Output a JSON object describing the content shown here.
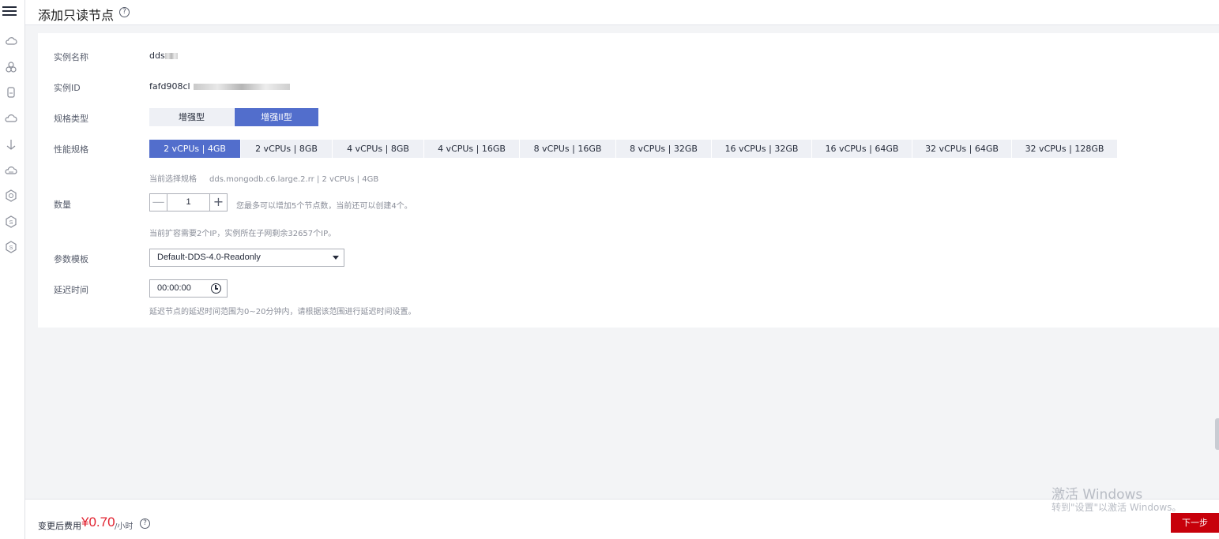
{
  "header": {
    "title": "添加只读节点",
    "help_icon": "question-circle-icon"
  },
  "rail": {
    "icons": [
      "cloud-icon",
      "cluster-icon",
      "database-icon",
      "cloud-outline-icon",
      "anchor-icon",
      "cloud-dots-icon",
      "hexagon-icon",
      "hexagon-s-icon",
      "hexagon-s2-icon"
    ]
  },
  "form": {
    "instance_name": {
      "label": "实例名称",
      "value": "dds"
    },
    "instance_id": {
      "label": "实例ID",
      "value": "fafd908cl"
    },
    "spec_type": {
      "label": "规格类型",
      "options": [
        "增强型",
        "增强II型"
      ],
      "selected": "增强II型"
    },
    "perf_spec": {
      "label": "性能规格",
      "options": [
        "2 vCPUs | 4GB",
        "2 vCPUs | 8GB",
        "4 vCPUs | 8GB",
        "4 vCPUs | 16GB",
        "8 vCPUs | 16GB",
        "8 vCPUs | 32GB",
        "16 vCPUs | 32GB",
        "16 vCPUs | 64GB",
        "32 vCPUs | 64GB",
        "32 vCPUs | 128GB"
      ],
      "selected": "2 vCPUs | 4GB"
    },
    "current_spec": {
      "label": "当前选择规格",
      "value": "dds.mongodb.c6.large.2.rr | 2 vCPUs | 4GB"
    },
    "quantity": {
      "label": "数量",
      "value": "1",
      "minus": "—",
      "plus": "+",
      "note": "您最多可以增加5个节点数，当前还可以创建4个。",
      "ip_note": "当前扩容需要2个IP，实例所在子网剩余32657个IP。"
    },
    "param_template": {
      "label": "参数模板",
      "value": "Default-DDS-4.0-Readonly"
    },
    "delay": {
      "label": "延迟时间",
      "value": "00:00:00",
      "note": "延迟节点的延迟时间范围为0~20分钟内，请根据该范围进行延迟时间设置。"
    }
  },
  "footer": {
    "fee_label": "变更后费用",
    "price": "¥0.70",
    "unit": "/小时",
    "next_button": "下一步"
  },
  "watermark": {
    "line1": "激活 Windows",
    "line2": "转到\"设置\"以激活 Windows。"
  },
  "colors": {
    "accent": "#526ecc",
    "price": "#e1202e",
    "primary_button": "#c7000b"
  }
}
